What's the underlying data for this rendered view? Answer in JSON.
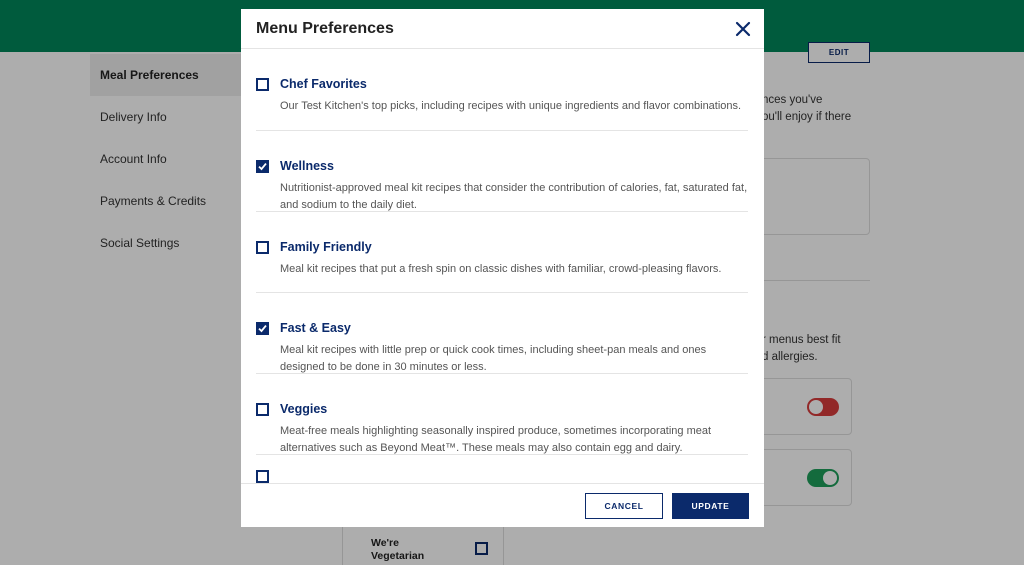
{
  "sidebar": {
    "items": [
      {
        "label": "Meal Preferences"
      },
      {
        "label": "Delivery Info"
      },
      {
        "label": "Account Info"
      },
      {
        "label": "Payments & Credits"
      },
      {
        "label": "Social Settings"
      }
    ]
  },
  "background": {
    "edit_label": "EDIT",
    "text_1_line_1": "nces you've",
    "text_1_line_2": "ou'll enjoy if there",
    "text_2_line_1": "r menus best fit",
    "text_2_line_2": "d allergies.",
    "veg_card_label": "We're Vegetarian"
  },
  "modal": {
    "title": "Menu Preferences",
    "preferences": [
      {
        "title": "Chef Favorites",
        "description": "Our Test Kitchen's top picks, including recipes with unique ingredients and flavor combinations.",
        "checked": false
      },
      {
        "title": "Wellness",
        "description": "Nutritionist-approved meal kit recipes that consider the contribution of calories, fat, saturated fat, and sodium to the daily diet.",
        "checked": true
      },
      {
        "title": "Family Friendly",
        "description": "Meal kit recipes that put a fresh spin on classic dishes with familiar, crowd-pleasing flavors.",
        "checked": false
      },
      {
        "title": "Fast & Easy",
        "description": "Meal kit recipes with little prep or quick cook times, including sheet-pan meals and ones designed to be done in 30 minutes or less.",
        "checked": true
      },
      {
        "title": "Veggies",
        "description": "Meat-free meals highlighting seasonally inspired produce, sometimes incorporating meat alternatives such as Beyond Meat™. These meals may also contain egg and dairy.",
        "checked": false
      }
    ],
    "cancel_label": "CANCEL",
    "update_label": "UPDATE"
  },
  "colors": {
    "header_green": "#00875a",
    "brand_navy": "#0b2a6b",
    "toggle_off": "#d83b3b",
    "toggle_on": "#1e9e5a"
  },
  "icons": {
    "close": "close-icon",
    "check": "checkmark-icon"
  }
}
